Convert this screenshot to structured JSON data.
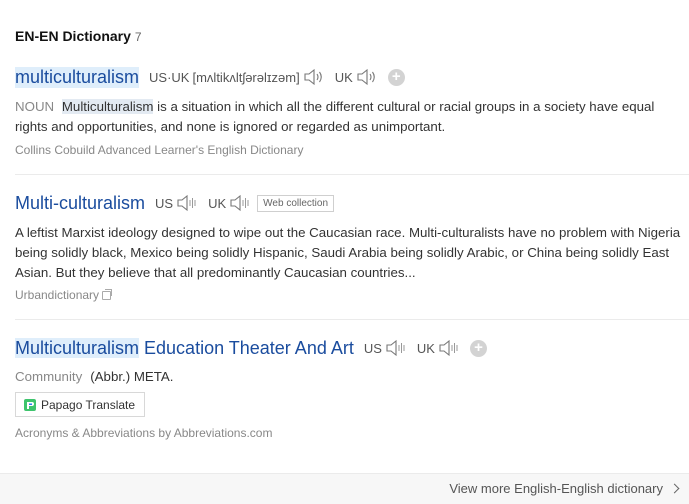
{
  "section": {
    "title": "EN-EN Dictionary",
    "count": "7"
  },
  "entries": [
    {
      "headword": "multiculturalism",
      "pron_label": "US·UK",
      "phonetic": "[mʌltikʌltʃərəlɪzəm]",
      "uk_label": "UK",
      "add_label": "+",
      "pos": "NOUN",
      "def_highlight": "Multiculturalism",
      "def_rest": " is a situation in which all the different cultural or racial groups in a society have equal rights and opportunities, and none is ignored or regarded as unimportant.",
      "source": "Collins Cobuild Advanced Learner's English Dictionary"
    },
    {
      "headword": "Multi-culturalism",
      "us_label": "US",
      "uk_label": "UK",
      "tag": "Web collection",
      "definition": "A leftist Marxist ideology designed to wipe out the Caucasian race. Multi-culturalists have no problem with Nigeria being solidly black, Mexico being solidly Hispanic, Saudi Arabia being solidly Arabic, or China being solidly East Asian. But they believe that all predominantly Caucasian countries...",
      "source": "Urbandictionary"
    },
    {
      "headword_highlight": "Multiculturalism",
      "headword_rest": " Education Theater And Art",
      "us_label": "US",
      "uk_label": "UK",
      "add_label": "+",
      "community_label": "Community",
      "definition": "(Abbr.) META.",
      "translate_button": "Papago Translate",
      "source": "Acronyms & Abbreviations by Abbreviations.com"
    }
  ],
  "footer": {
    "more_link": "View more English-English dictionary"
  },
  "colors": {
    "link": "#1a4c9e",
    "highlight": "#dfeefb",
    "muted": "#888888"
  },
  "icons": [
    "speaker-icon",
    "plus-icon",
    "copy-icon",
    "papago-logo-icon",
    "chevron-right-icon"
  ]
}
